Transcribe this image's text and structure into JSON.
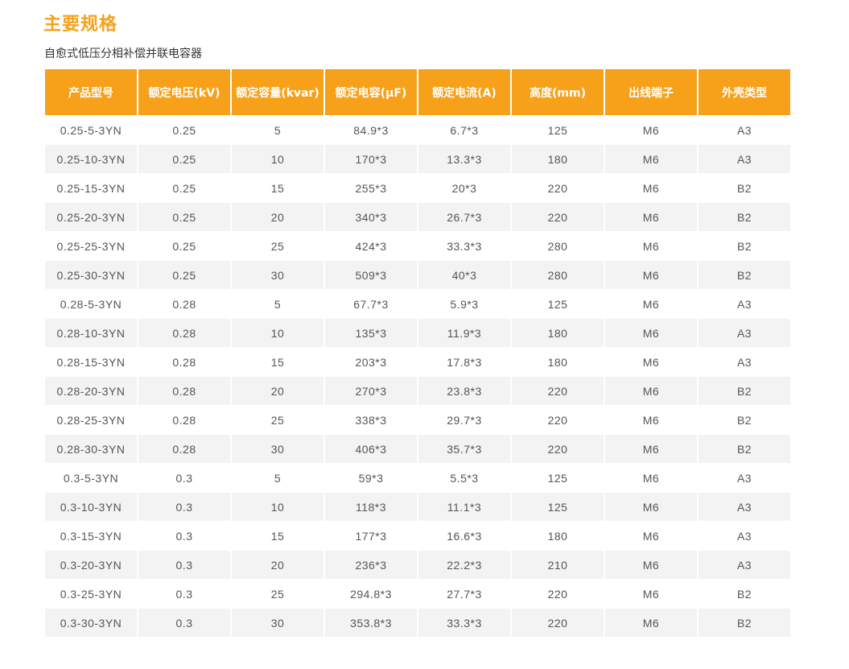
{
  "title": "主要规格",
  "subtitle": "自愈式低压分相补偿并联电容器",
  "colors": {
    "accent": "#f7a11a",
    "row_alt": "#f3f3f3",
    "text": "#555555"
  },
  "table": {
    "headers": [
      "产品型号",
      "额定电压(kV)",
      "额定容量(kvar)",
      "额定电容(μF)",
      "额定电流(A)",
      "高度(mm)",
      "出线端子",
      "外壳类型"
    ],
    "rows": [
      [
        "0.25-5-3YN",
        "0.25",
        "5",
        "84.9*3",
        "6.7*3",
        "125",
        "M6",
        "A3"
      ],
      [
        "0.25-10-3YN",
        "0.25",
        "10",
        "170*3",
        "13.3*3",
        "180",
        "M6",
        "A3"
      ],
      [
        "0.25-15-3YN",
        "0.25",
        "15",
        "255*3",
        "20*3",
        "220",
        "M6",
        "B2"
      ],
      [
        "0.25-20-3YN",
        "0.25",
        "20",
        "340*3",
        "26.7*3",
        "220",
        "M6",
        "B2"
      ],
      [
        "0.25-25-3YN",
        "0.25",
        "25",
        "424*3",
        "33.3*3",
        "280",
        "M6",
        "B2"
      ],
      [
        "0.25-30-3YN",
        "0.25",
        "30",
        "509*3",
        "40*3",
        "280",
        "M6",
        "B2"
      ],
      [
        "0.28-5-3YN",
        "0.28",
        "5",
        "67.7*3",
        "5.9*3",
        "125",
        "M6",
        "A3"
      ],
      [
        "0.28-10-3YN",
        "0.28",
        "10",
        "135*3",
        "11.9*3",
        "180",
        "M6",
        "A3"
      ],
      [
        "0.28-15-3YN",
        "0.28",
        "15",
        "203*3",
        "17.8*3",
        "180",
        "M6",
        "A3"
      ],
      [
        "0.28-20-3YN",
        "0.28",
        "20",
        "270*3",
        "23.8*3",
        "220",
        "M6",
        "B2"
      ],
      [
        "0.28-25-3YN",
        "0.28",
        "25",
        "338*3",
        "29.7*3",
        "220",
        "M6",
        "B2"
      ],
      [
        "0.28-30-3YN",
        "0.28",
        "30",
        "406*3",
        "35.7*3",
        "220",
        "M6",
        "B2"
      ],
      [
        "0.3-5-3YN",
        "0.3",
        "5",
        "59*3",
        "5.5*3",
        "125",
        "M6",
        "A3"
      ],
      [
        "0.3-10-3YN",
        "0.3",
        "10",
        "118*3",
        "11.1*3",
        "125",
        "M6",
        "A3"
      ],
      [
        "0.3-15-3YN",
        "0.3",
        "15",
        "177*3",
        "16.6*3",
        "180",
        "M6",
        "A3"
      ],
      [
        "0.3-20-3YN",
        "0.3",
        "20",
        "236*3",
        "22.2*3",
        "210",
        "M6",
        "A3"
      ],
      [
        "0.3-25-3YN",
        "0.3",
        "25",
        "294.8*3",
        "27.7*3",
        "220",
        "M6",
        "B2"
      ],
      [
        "0.3-30-3YN",
        "0.3",
        "30",
        "353.8*3",
        "33.3*3",
        "220",
        "M6",
        "B2"
      ]
    ]
  }
}
